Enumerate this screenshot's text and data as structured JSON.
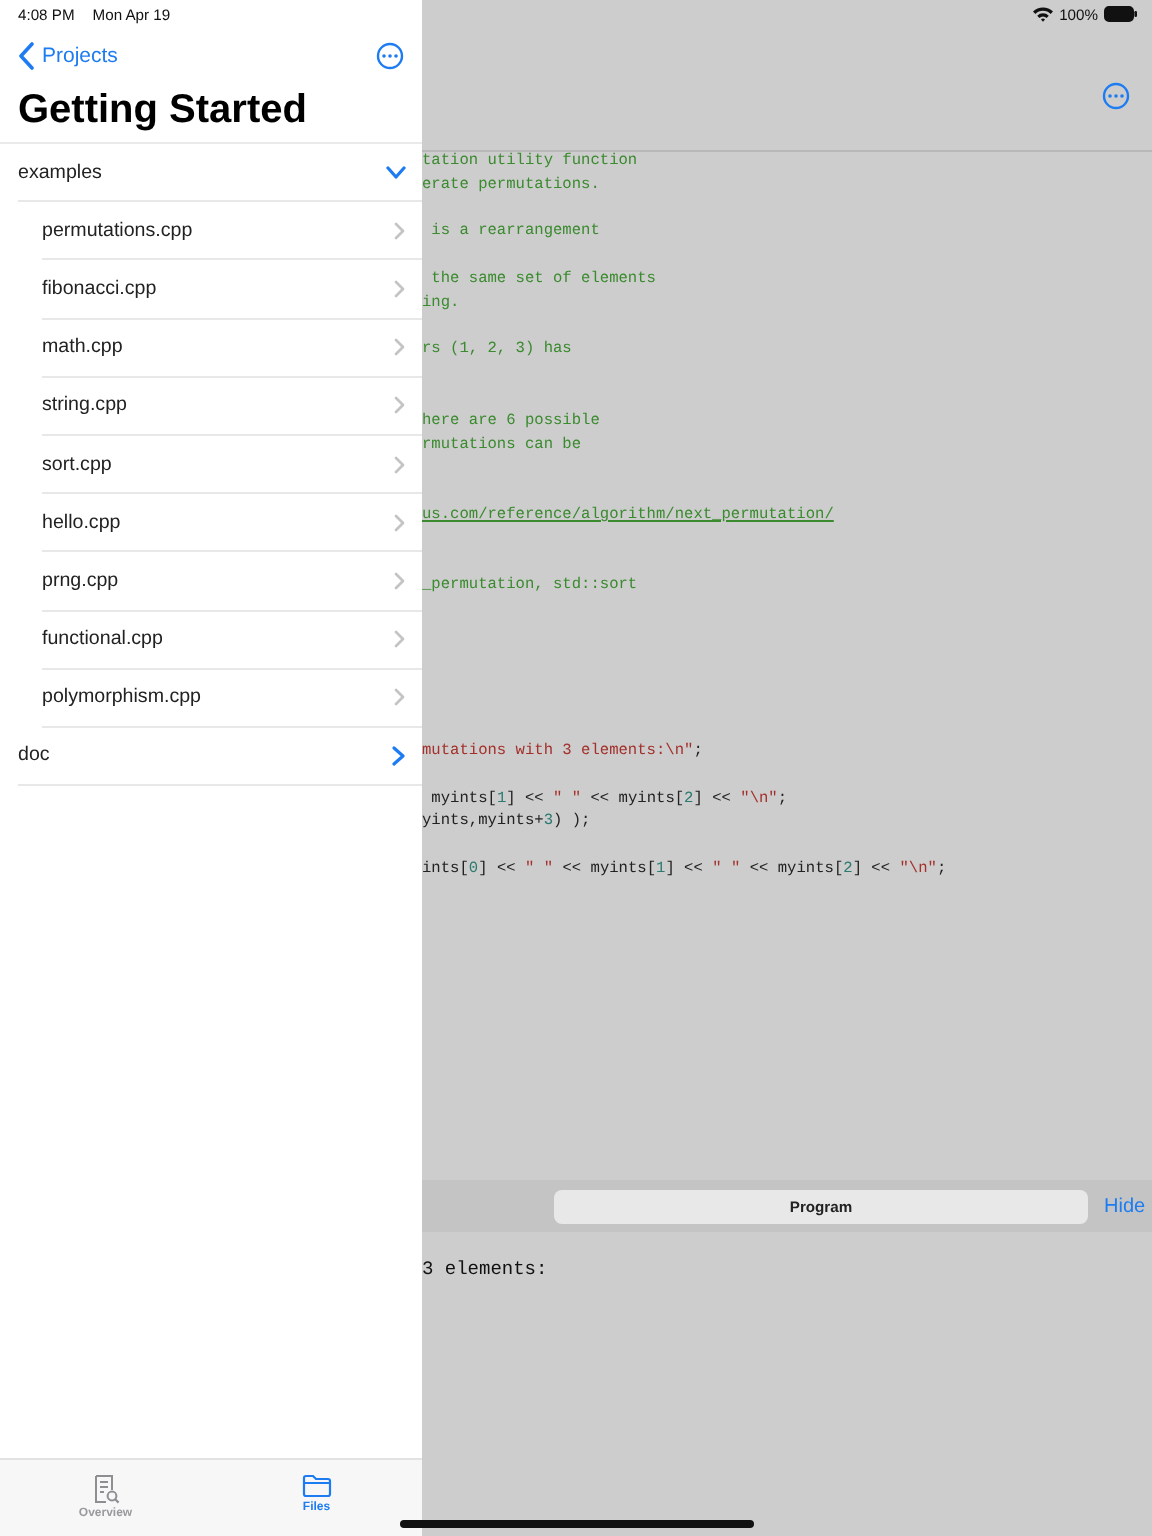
{
  "status_bar": {
    "time": "4:08 PM",
    "date": "Mon Apr 19",
    "battery": "100%"
  },
  "sidebar": {
    "back_label": "Projects",
    "title": "Getting Started",
    "tree": [
      {
        "kind": "folder",
        "label": "examples",
        "expanded": true,
        "children": [
          {
            "kind": "file",
            "label": "permutations.cpp"
          },
          {
            "kind": "file",
            "label": "fibonacci.cpp"
          },
          {
            "kind": "file",
            "label": "math.cpp"
          },
          {
            "kind": "file",
            "label": "string.cpp"
          },
          {
            "kind": "file",
            "label": "sort.cpp"
          },
          {
            "kind": "file",
            "label": "hello.cpp"
          },
          {
            "kind": "file",
            "label": "prng.cpp"
          },
          {
            "kind": "file",
            "label": "functional.cpp"
          },
          {
            "kind": "file",
            "label": "polymorphism.cpp"
          }
        ]
      },
      {
        "kind": "folder",
        "label": "doc",
        "expanded": false
      }
    ]
  },
  "tab_bar": [
    {
      "kind": "overview",
      "label": "Overview",
      "selected": false
    },
    {
      "kind": "files",
      "label": "Files",
      "selected": true
    }
  ],
  "editor": {
    "lines": [
      {
        "kind": "code",
        "segments": [
          {
            "kind": "comment",
            "text": "tation utility function"
          }
        ]
      },
      {
        "kind": "code",
        "segments": [
          {
            "kind": "comment",
            "text": "erate permutations."
          }
        ]
      },
      {
        "kind": "blank"
      },
      {
        "kind": "code",
        "segments": [
          {
            "kind": "comment",
            "text": " is a rearrangement"
          }
        ]
      },
      {
        "kind": "blank"
      },
      {
        "kind": "code",
        "segments": [
          {
            "kind": "comment",
            "text": " the same set of elements"
          }
        ]
      },
      {
        "kind": "code",
        "segments": [
          {
            "kind": "comment",
            "text": "ing."
          }
        ]
      },
      {
        "kind": "blank"
      },
      {
        "kind": "code",
        "segments": [
          {
            "kind": "comment",
            "text": "rs (1, 2, 3) has"
          }
        ]
      },
      {
        "kind": "blank"
      },
      {
        "kind": "blank"
      },
      {
        "kind": "code",
        "segments": [
          {
            "kind": "comment",
            "text": "here are 6 possible"
          }
        ]
      },
      {
        "kind": "code",
        "segments": [
          {
            "kind": "comment",
            "text": "rmutations can be"
          }
        ]
      },
      {
        "kind": "blank"
      },
      {
        "kind": "blank"
      },
      {
        "kind": "code",
        "segments": [
          {
            "kind": "link",
            "text": "us.com/reference/algorithm/next_permutation/"
          }
        ]
      },
      {
        "kind": "blank"
      },
      {
        "kind": "blank"
      },
      {
        "kind": "code",
        "segments": [
          {
            "kind": "comment",
            "text": "_permutation, std::sort"
          }
        ]
      },
      {
        "kind": "blank"
      },
      {
        "kind": "blank"
      },
      {
        "kind": "blank"
      },
      {
        "kind": "blank"
      },
      {
        "kind": "blank"
      },
      {
        "kind": "blank"
      },
      {
        "kind": "code",
        "segments": [
          {
            "kind": "string",
            "text": "mutations with 3 elements:\\n\""
          },
          {
            "kind": "plain",
            "text": ";"
          }
        ]
      },
      {
        "kind": "blank"
      },
      {
        "kind": "code",
        "segments": [
          {
            "kind": "plain",
            "text": " myints["
          },
          {
            "kind": "number",
            "text": "1"
          },
          {
            "kind": "plain",
            "text": "] << "
          },
          {
            "kind": "string",
            "text": "\" \""
          },
          {
            "kind": "plain",
            "text": " << myints["
          },
          {
            "kind": "number",
            "text": "2"
          },
          {
            "kind": "plain",
            "text": "] << "
          },
          {
            "kind": "string",
            "text": "\"\\n\""
          },
          {
            "kind": "plain",
            "text": ";"
          }
        ]
      },
      {
        "kind": "code",
        "segments": [
          {
            "kind": "plain",
            "text": "yints,myints+"
          },
          {
            "kind": "number",
            "text": "3"
          },
          {
            "kind": "plain",
            "text": ") );"
          }
        ]
      },
      {
        "kind": "blank"
      },
      {
        "kind": "code",
        "segments": [
          {
            "kind": "plain",
            "text": "ints["
          },
          {
            "kind": "number",
            "text": "0"
          },
          {
            "kind": "plain",
            "text": "] << "
          },
          {
            "kind": "string",
            "text": "\" \""
          },
          {
            "kind": "plain",
            "text": " << myints["
          },
          {
            "kind": "number",
            "text": "1"
          },
          {
            "kind": "plain",
            "text": "] << "
          },
          {
            "kind": "string",
            "text": "\" \""
          },
          {
            "kind": "plain",
            "text": " << myints["
          },
          {
            "kind": "number",
            "text": "2"
          },
          {
            "kind": "plain",
            "text": "] << "
          },
          {
            "kind": "string",
            "text": "\"\\n\""
          },
          {
            "kind": "plain",
            "text": ";"
          }
        ]
      }
    ]
  },
  "output_panel": {
    "segment": "Program",
    "hide_button": "Hide",
    "lines": [
      "3 elements:"
    ]
  }
}
